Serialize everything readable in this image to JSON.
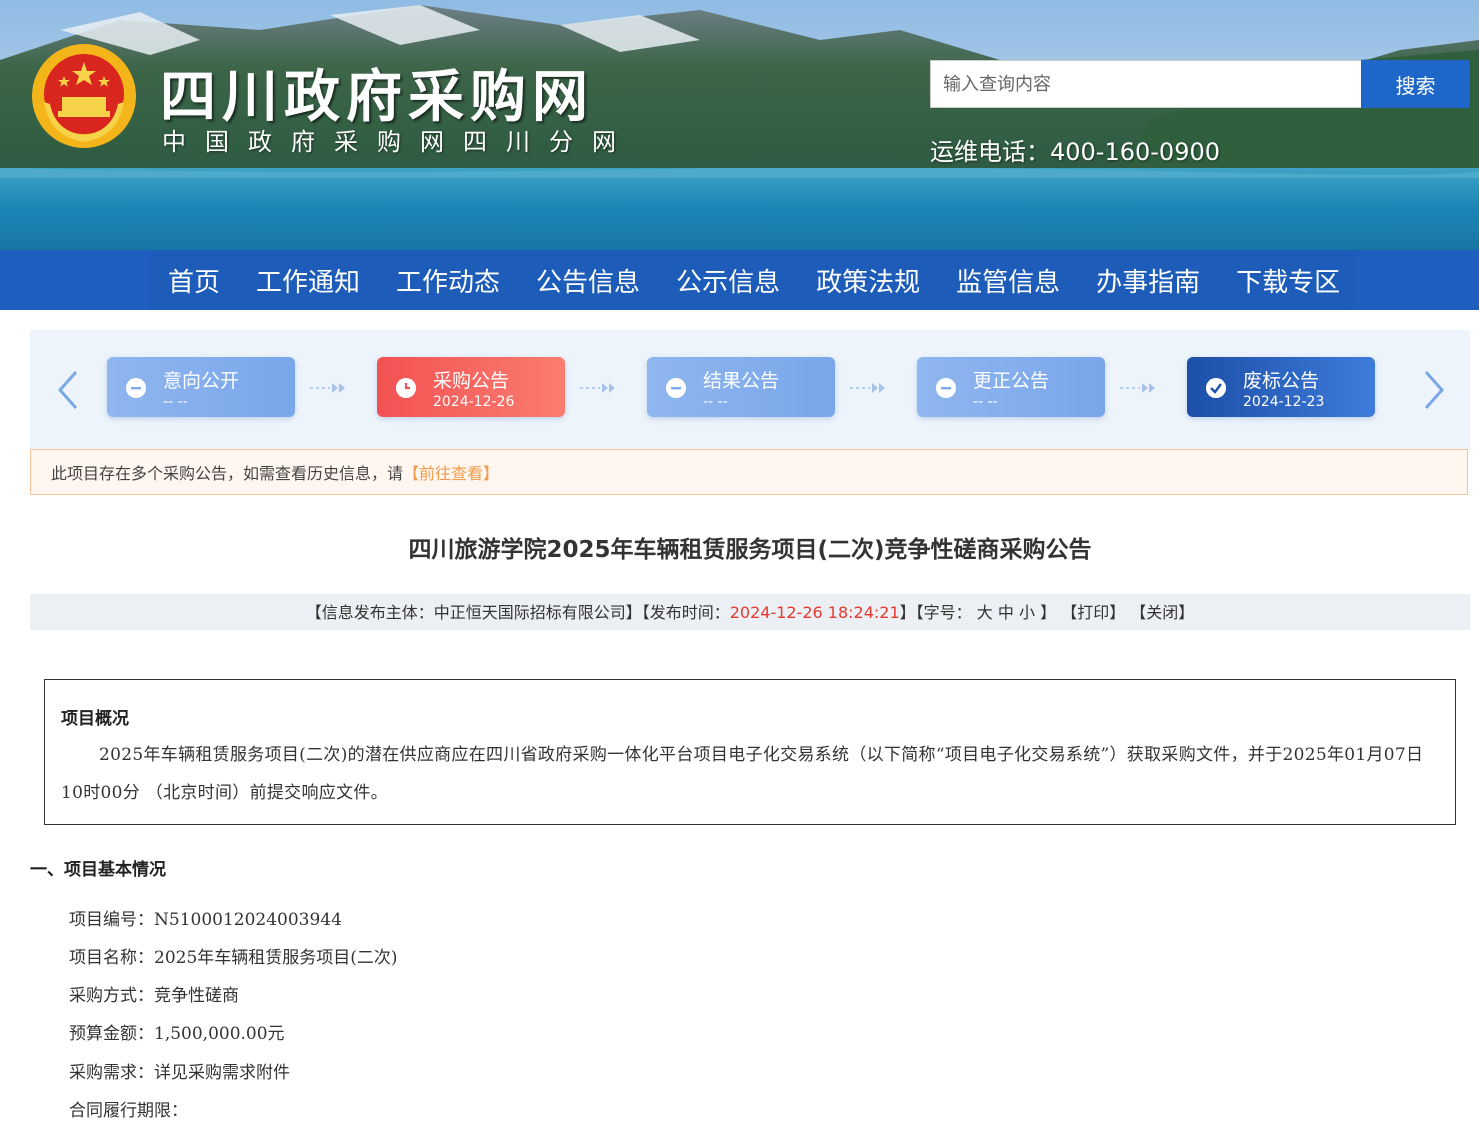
{
  "header": {
    "site_title": "四川政府采购网",
    "site_subtitle": "中国政府采购网四川分网",
    "search_placeholder": "输入查询内容",
    "search_button": "搜索",
    "hotline": "运维电话：400-160-0900"
  },
  "nav": {
    "items": [
      "首页",
      "工作通知",
      "工作动态",
      "公告信息",
      "公示信息",
      "政策法规",
      "监管信息",
      "办事指南",
      "下载专区"
    ]
  },
  "steps": [
    {
      "label": "意向公开",
      "date": "-- --",
      "state": "idle"
    },
    {
      "label": "采购公告",
      "date": "2024-12-26",
      "state": "current"
    },
    {
      "label": "结果公告",
      "date": "-- --",
      "state": "idle"
    },
    {
      "label": "更正公告",
      "date": "-- --",
      "state": "idle"
    },
    {
      "label": "废标公告",
      "date": "2024-12-23",
      "state": "done"
    }
  ],
  "notice": {
    "text": "此项目存在多个采购公告，如需查看历史信息，请",
    "link": "【前往查看】"
  },
  "article": {
    "title": "四川旅游学院2025年车辆租赁服务项目(二次)竞争性磋商采购公告",
    "meta": {
      "publisher_prefix": "【信息发布主体：中正恒天国际招标有限公司】【发布时间：",
      "publish_time": "2024-12-26 18:24:21",
      "font_prefix": "】【字号：",
      "font_large": "大",
      "font_medium": "中",
      "font_small": "小",
      "font_suffix": "】",
      "print": "【打印】",
      "close": "【关闭】"
    },
    "overview": {
      "heading": "项目概况",
      "paragraph": "2025年车辆租赁服务项目(二次)的潜在供应商应在四川省政府采购一体化平台项目电子化交易系统（以下简称“项目电子化交易系统”）获取采购文件，并于2025年01月07日  10时00分  （北京时间）前提交响应文件。"
    },
    "section1_title": "一、项目基本情况",
    "basic_info": [
      "项目编号：N5100012024003944",
      "项目名称：2025年车辆租赁服务项目(二次)",
      "采购方式：竞争性磋商",
      "预算金额：1,500,000.00元",
      "采购需求：详见采购需求附件",
      "合同履行期限："
    ]
  },
  "colors": {
    "nav_blue": "#1e5fbf",
    "step_current": "#f25253",
    "step_done": "#1c4fa8",
    "step_idle": "#8fb6ef",
    "notice_link": "#f29b4b",
    "publish_time": "#e53a2f"
  }
}
